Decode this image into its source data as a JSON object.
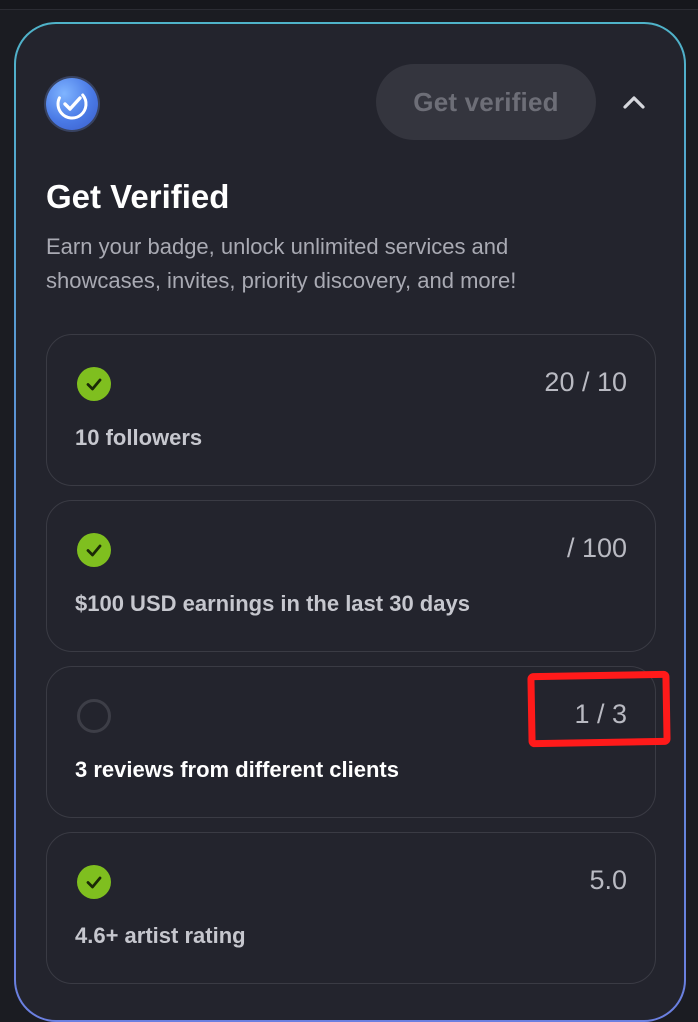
{
  "header": {
    "cta_label": "Get verified"
  },
  "panel": {
    "title": "Get Verified",
    "subtitle": "Earn your badge, unlock unlimited services and showcases, invites, priority discovery, and more!"
  },
  "requirements": [
    {
      "label": "10 followers",
      "progress": "20 / 10",
      "completed": true
    },
    {
      "label": "$100 USD earnings in the last 30 days",
      "progress": "/ 100",
      "completed": true
    },
    {
      "label": "3 reviews from different clients",
      "progress": "1 / 3",
      "completed": false
    },
    {
      "label": "4.6+ artist rating",
      "progress": "5.0",
      "completed": true
    }
  ],
  "colors": {
    "card_background": "#23242d",
    "check_green": "#7fbf1f",
    "annotation_red": "#ff1a1a",
    "gradient_border": "#5d8fd6"
  },
  "icons": {
    "badge": "verified-badge-icon",
    "collapse": "chevron-up-icon",
    "done": "checkmark-icon",
    "pending": "empty-circle-icon"
  }
}
